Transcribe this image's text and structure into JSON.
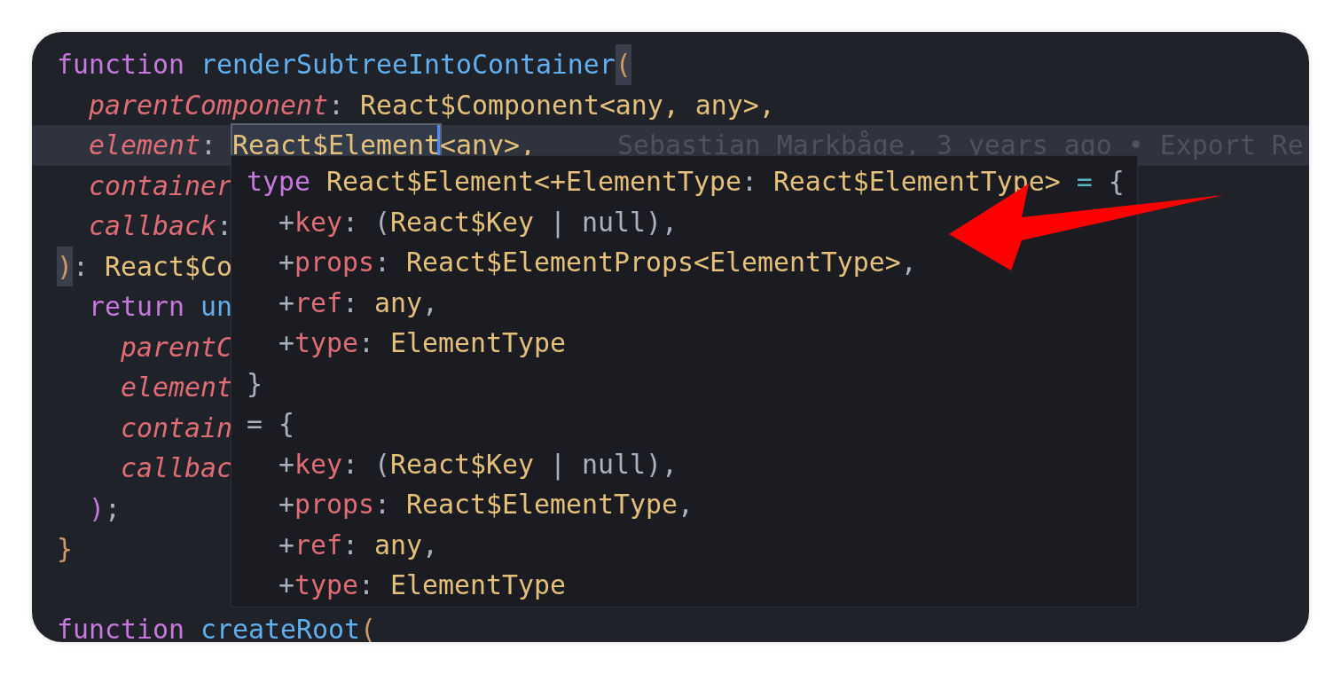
{
  "editor": {
    "lines": [
      {
        "current": false,
        "tokens": [
          {
            "text": "function ",
            "kind": "keyword"
          },
          {
            "text": "renderSubtreeIntoContainer",
            "kind": "function"
          },
          {
            "text": "(",
            "kind": "bracket-match"
          }
        ]
      },
      {
        "current": false,
        "tokens": [
          {
            "text": "  parentComponent",
            "kind": "param"
          },
          {
            "text": ": ",
            "kind": "punct"
          },
          {
            "text": "React$Component",
            "kind": "type"
          },
          {
            "text": "<any, any>,",
            "kind": "type"
          }
        ]
      },
      {
        "current": true,
        "blame": "Sebastian Markbåge, 3 years ago • Export Re",
        "tokens": [
          {
            "text": "  element",
            "kind": "param"
          },
          {
            "text": ": ",
            "kind": "punct"
          },
          {
            "text": "React$Element",
            "kind": "highlight"
          },
          {
            "text": "<any>,",
            "kind": "type"
          }
        ]
      },
      {
        "current": false,
        "tokens": [
          {
            "text": "  container",
            "kind": "param"
          }
        ]
      },
      {
        "current": false,
        "tokens": [
          {
            "text": "  callback",
            "kind": "param"
          },
          {
            "text": ":",
            "kind": "punct"
          }
        ]
      },
      {
        "current": false,
        "tokens": [
          {
            "text": ")",
            "kind": "bracket-match"
          },
          {
            "text": ": ",
            "kind": "punct"
          },
          {
            "text": "React$Co",
            "kind": "type"
          }
        ]
      },
      {
        "current": false,
        "tokens": [
          {
            "text": "  return ",
            "kind": "keyword"
          },
          {
            "text": "un",
            "kind": "function"
          }
        ]
      },
      {
        "current": false,
        "tokens": [
          {
            "text": "    parentC",
            "kind": "param"
          }
        ]
      },
      {
        "current": false,
        "tokens": [
          {
            "text": "    element",
            "kind": "param"
          }
        ]
      },
      {
        "current": false,
        "tokens": [
          {
            "text": "    contain",
            "kind": "param"
          }
        ]
      },
      {
        "current": false,
        "tokens": [
          {
            "text": "    callbac",
            "kind": "param"
          }
        ]
      },
      {
        "current": false,
        "tokens": [
          {
            "text": "  )",
            "kind": "keyword"
          },
          {
            "text": ";",
            "kind": "punct"
          }
        ]
      },
      {
        "current": false,
        "tokens": [
          {
            "text": "}",
            "kind": "bracket"
          }
        ]
      },
      {
        "current": false
      },
      {
        "current": false,
        "tokens": [
          {
            "text": "function ",
            "kind": "keyword"
          },
          {
            "text": "createRoot",
            "kind": "function"
          },
          {
            "text": "(",
            "kind": "bracket"
          }
        ]
      }
    ]
  },
  "hover_popup": {
    "lines": [
      {
        "tokens": [
          {
            "text": "type ",
            "kind": "keyword"
          },
          {
            "text": "React$Element<+ElementType",
            "kind": "type"
          },
          {
            "text": ": ",
            "kind": "punct"
          },
          {
            "text": "React$ElementType>",
            "kind": "type"
          },
          {
            "text": " = ",
            "kind": "operator"
          },
          {
            "text": "{",
            "kind": "punct"
          }
        ]
      },
      {
        "tokens": [
          {
            "text": "  +",
            "kind": "punct"
          },
          {
            "text": "key",
            "kind": "param"
          },
          {
            "text": ": (",
            "kind": "punct"
          },
          {
            "text": "React$Key",
            "kind": "type"
          },
          {
            "text": " | null),",
            "kind": "punct"
          }
        ]
      },
      {
        "tokens": [
          {
            "text": "  +",
            "kind": "punct"
          },
          {
            "text": "props",
            "kind": "param"
          },
          {
            "text": ": ",
            "kind": "punct"
          },
          {
            "text": "React$ElementProps<ElementType>",
            "kind": "type"
          },
          {
            "text": ",",
            "kind": "punct"
          }
        ]
      },
      {
        "tokens": [
          {
            "text": "  +",
            "kind": "punct"
          },
          {
            "text": "ref",
            "kind": "param"
          },
          {
            "text": ": ",
            "kind": "punct"
          },
          {
            "text": "any",
            "kind": "type"
          },
          {
            "text": ",",
            "kind": "punct"
          }
        ]
      },
      {
        "tokens": [
          {
            "text": "  +",
            "kind": "punct"
          },
          {
            "text": "type",
            "kind": "param"
          },
          {
            "text": ": ",
            "kind": "punct"
          },
          {
            "text": "ElementType",
            "kind": "type"
          }
        ]
      },
      {
        "tokens": [
          {
            "text": "}",
            "kind": "punct"
          }
        ]
      },
      {
        "tokens": [
          {
            "text": "= ",
            "kind": "punct"
          },
          {
            "text": "{",
            "kind": "punct"
          }
        ]
      },
      {
        "tokens": [
          {
            "text": "  +",
            "kind": "punct"
          },
          {
            "text": "key",
            "kind": "param"
          },
          {
            "text": ": (",
            "kind": "punct"
          },
          {
            "text": "React$Key",
            "kind": "type"
          },
          {
            "text": " | null),",
            "kind": "punct"
          }
        ]
      },
      {
        "tokens": [
          {
            "text": "  +",
            "kind": "punct"
          },
          {
            "text": "props",
            "kind": "param"
          },
          {
            "text": ": ",
            "kind": "punct"
          },
          {
            "text": "React$ElementType",
            "kind": "type"
          },
          {
            "text": ",",
            "kind": "punct"
          }
        ]
      },
      {
        "tokens": [
          {
            "text": "  +",
            "kind": "punct"
          },
          {
            "text": "ref",
            "kind": "param"
          },
          {
            "text": ": ",
            "kind": "punct"
          },
          {
            "text": "any",
            "kind": "type"
          },
          {
            "text": ",",
            "kind": "punct"
          }
        ]
      },
      {
        "tokens": [
          {
            "text": "  +",
            "kind": "punct"
          },
          {
            "text": "type",
            "kind": "param"
          },
          {
            "text": ": ",
            "kind": "punct"
          },
          {
            "text": "ElementType",
            "kind": "type"
          }
        ]
      }
    ]
  }
}
